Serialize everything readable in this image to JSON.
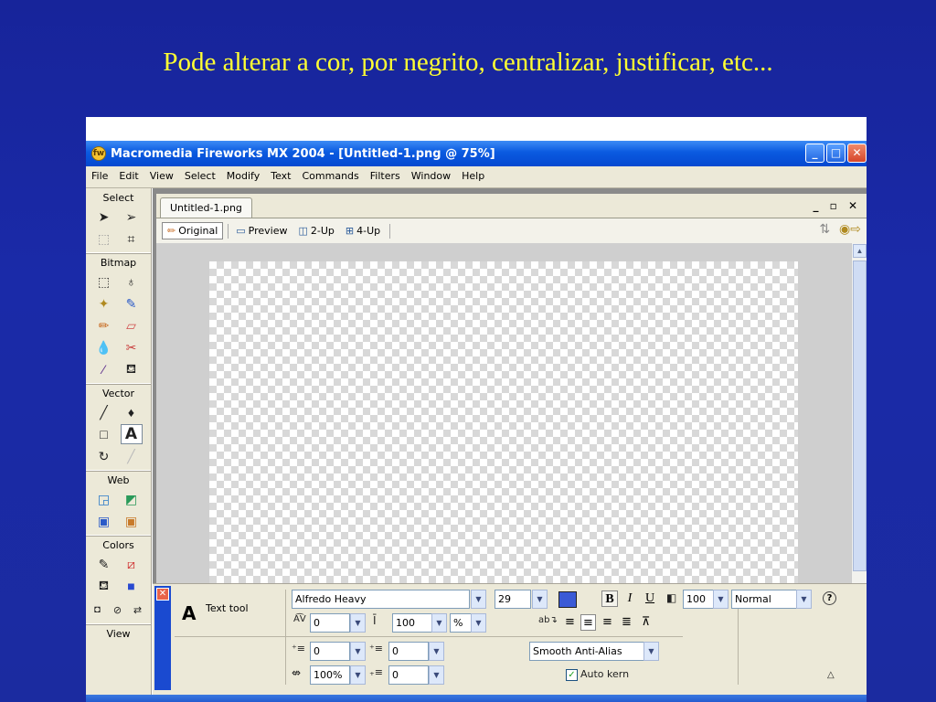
{
  "slide": {
    "title": "Pode alterar a cor, por negrito, centralizar, justificar, etc..."
  },
  "window": {
    "title": "Macromedia Fireworks MX 2004 - [Untitled-1.png @  75%]",
    "minimize": "_",
    "maximize": "□",
    "close": "✕"
  },
  "menu": [
    "File",
    "Edit",
    "View",
    "Select",
    "Modify",
    "Text",
    "Commands",
    "Filters",
    "Window",
    "Help"
  ],
  "tools": {
    "select": "Select",
    "bitmap": "Bitmap",
    "vector": "Vector",
    "web": "Web",
    "colors": "Colors",
    "view": "View",
    "text_tool_glyph": "A"
  },
  "document": {
    "tab": "Untitled-1.png",
    "controls": "_ ▫ ✕",
    "views": {
      "original": "Original",
      "preview": "Preview",
      "two_up": "2-Up",
      "four_up": "4-Up"
    }
  },
  "properties": {
    "tool_glyph": "A",
    "tool_label": "Text tool",
    "font": "Alfredo Heavy",
    "size": "29",
    "bold": "B",
    "italic": "I",
    "underline": "U",
    "kerning": "0",
    "leading": "100",
    "leading_unit": "%",
    "opacity": "100",
    "blend_mode": "Normal",
    "indent": "0",
    "space_before": "0",
    "horizontal_scale": "100%",
    "space_after": "0",
    "anti_alias": "Smooth Anti-Alias",
    "auto_kern": "Auto kern",
    "fill_color": "#3a5ad6"
  }
}
